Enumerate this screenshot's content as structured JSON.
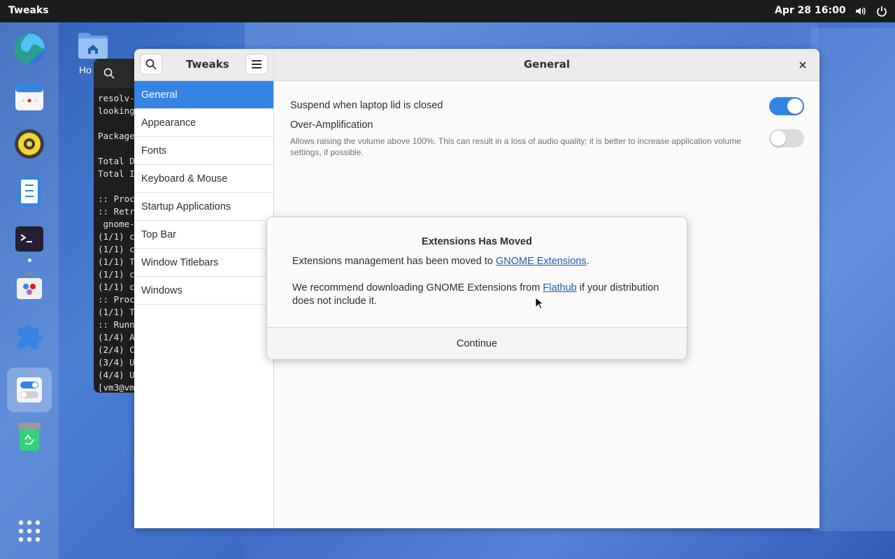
{
  "topbar": {
    "app_name": "Tweaks",
    "clock": "Apr 28  16:00",
    "tray": [
      "volume-icon",
      "power-icon"
    ]
  },
  "desktop": {
    "home_label": "Ho"
  },
  "terminal": {
    "lines": [
      "resolv-",
      "looking",
      "",
      "Package",
      "",
      "Total D",
      "Total I",
      "",
      ":: Proc",
      ":: Retr",
      " gnome-",
      "(1/1) c",
      "(1/1) c",
      "(1/1) T",
      "(1/1) c",
      "(1/1) c",
      ":: Proc",
      "(1/1) T",
      ":: Runn",
      "(1/4) A",
      "(2/4) C",
      "(3/4) U",
      "(4/4) U",
      "[vm3@vm"
    ]
  },
  "window": {
    "sidebar_title": "Tweaks",
    "page_title": "General",
    "sidebar_items": [
      {
        "label": "General"
      },
      {
        "label": "Appearance"
      },
      {
        "label": "Fonts"
      },
      {
        "label": "Keyboard & Mouse"
      },
      {
        "label": "Startup Applications"
      },
      {
        "label": "Top Bar"
      },
      {
        "label": "Window Titlebars"
      },
      {
        "label": "Windows"
      }
    ],
    "settings": {
      "suspend_label": "Suspend when laptop lid is closed",
      "suspend_on": true,
      "overamp_label": "Over-Amplification",
      "overamp_desc": "Allows raising the volume above 100%. This can result in a loss of audio quality; it is better to increase application volume settings, if possible.",
      "overamp_on": false
    }
  },
  "dialog": {
    "title": "Extensions Has Moved",
    "p1_before": "Extensions management has been moved to ",
    "p1_link": "GNOME Extensions",
    "p1_after": ".",
    "p2_before": "We recommend downloading GNOME Extensions from ",
    "p2_link": "Flathub",
    "p2_after": " if your distribution does not include it.",
    "button": "Continue"
  },
  "colors": {
    "accent": "#3584e4",
    "link": "#1a5fb4"
  }
}
